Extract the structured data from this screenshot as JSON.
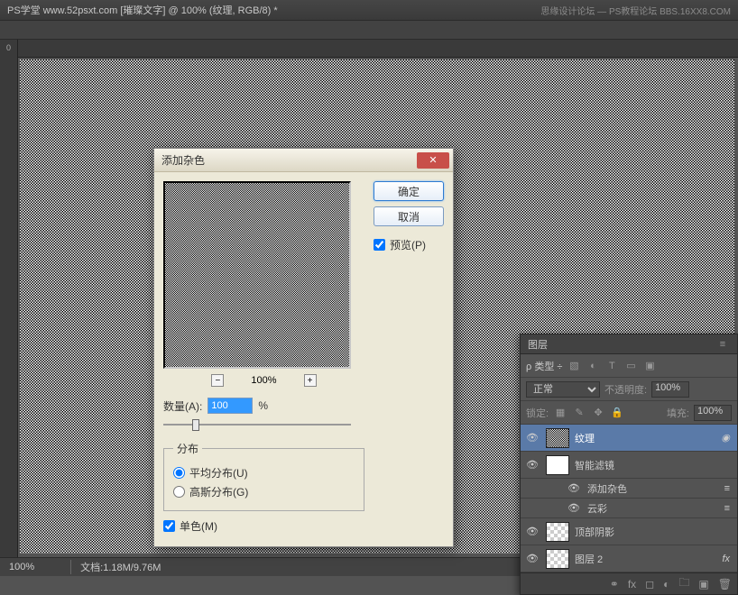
{
  "title": "PS学堂 www.52psxt.com [璀璨文字] @ 100% (纹理, RGB/8) *",
  "title_right": "思缘设计论坛 — PS教程论坛 BBS.16XX8.COM",
  "statusbar": {
    "zoom": "100%",
    "doc": "文档:1.18M/9.76M"
  },
  "dialog": {
    "title": "添加杂色",
    "ok": "确定",
    "cancel": "取消",
    "preview_label": "预览(P)",
    "zoom": "100%",
    "amount_label": "数量(A):",
    "amount_value": "100",
    "amount_unit": "%",
    "distribution_legend": "分布",
    "uniform": "平均分布(U)",
    "gaussian": "高斯分布(G)",
    "mono": "单色(M)"
  },
  "layers_panel": {
    "tab": "图层",
    "kind": "类型",
    "blend": "正常",
    "opacity_label": "不透明度:",
    "opacity": "100%",
    "lock_label": "锁定:",
    "fill_label": "填充:",
    "fill": "100%",
    "items": [
      {
        "name": "纹理"
      },
      {
        "name": "智能滤镜"
      },
      {
        "name": "添加杂色"
      },
      {
        "name": "云彩"
      },
      {
        "name": "顶部阴影"
      },
      {
        "name": "图层 2"
      }
    ],
    "fx": "fx"
  }
}
